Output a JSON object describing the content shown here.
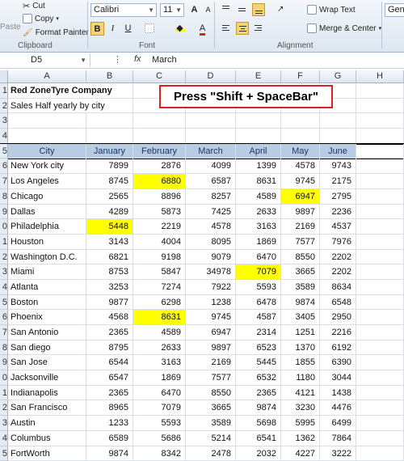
{
  "ribbon": {
    "clipboard": {
      "paste": "Paste",
      "cut": "Cut",
      "copy": "Copy",
      "format_painter": "Format Painter",
      "label": "Clipboard"
    },
    "font": {
      "name": "Calibri",
      "size": "11",
      "bold": "B",
      "italic": "I",
      "underline": "U",
      "grow": "A",
      "shrink": "A",
      "label": "Font"
    },
    "alignment": {
      "wrap_text": "Wrap Text",
      "merge_center": "Merge & Center",
      "label": "Alignment"
    },
    "number": {
      "format": "Gene"
    }
  },
  "formula_bar": {
    "name_box": "D5",
    "fx": "fx",
    "value": "March"
  },
  "columns": [
    "A",
    "B",
    "C",
    "D",
    "E",
    "F",
    "G",
    "H"
  ],
  "title_rows": {
    "company": "Red ZoneTyre Company",
    "subtitle": "Sales Half yearly by city"
  },
  "callout": "Press \"Shift + SpaceBar\"",
  "table": {
    "headers": [
      "City",
      "January",
      "February",
      "March",
      "April",
      "May",
      "June"
    ],
    "rows": [
      {
        "rownum": "6",
        "cells": [
          "New York city",
          "7899",
          "2876",
          "4099",
          "1399",
          "4578",
          "9743"
        ]
      },
      {
        "rownum": "7",
        "cells": [
          "Los Angeles",
          "8745",
          "6880",
          "6587",
          "8631",
          "9745",
          "2175"
        ]
      },
      {
        "rownum": "8",
        "cells": [
          "Chicago",
          "2565",
          "8896",
          "8257",
          "4589",
          "6947",
          "2795"
        ]
      },
      {
        "rownum": "9",
        "cells": [
          "Dallas",
          "4289",
          "5873",
          "7425",
          "2633",
          "9897",
          "2236"
        ]
      },
      {
        "rownum": "0",
        "cells": [
          "Philadelphia",
          "5448",
          "2219",
          "4578",
          "3163",
          "2169",
          "4537"
        ]
      },
      {
        "rownum": "1",
        "cells": [
          "Houston",
          "3143",
          "4004",
          "8095",
          "1869",
          "7577",
          "7976"
        ]
      },
      {
        "rownum": "2",
        "cells": [
          "Washington D.C.",
          "6821",
          "9198",
          "9079",
          "6470",
          "8550",
          "2202"
        ]
      },
      {
        "rownum": "3",
        "cells": [
          "Miami",
          "8753",
          "5847",
          "34978",
          "7079",
          "3665",
          "2202"
        ]
      },
      {
        "rownum": "4",
        "cells": [
          "Atlanta",
          "3253",
          "7274",
          "7922",
          "5593",
          "3589",
          "8634"
        ]
      },
      {
        "rownum": "5",
        "cells": [
          "Boston",
          "9877",
          "6298",
          "1238",
          "6478",
          "9874",
          "6548"
        ]
      },
      {
        "rownum": "6",
        "cells": [
          "Phoenix",
          "4568",
          "8631",
          "9745",
          "4587",
          "3405",
          "2950"
        ]
      },
      {
        "rownum": "7",
        "cells": [
          "San Antonio",
          "2365",
          "4589",
          "6947",
          "2314",
          "1251",
          "2216"
        ]
      },
      {
        "rownum": "8",
        "cells": [
          "San diego",
          "8795",
          "2633",
          "9897",
          "6523",
          "1370",
          "6192"
        ]
      },
      {
        "rownum": "9",
        "cells": [
          "San Jose",
          "6544",
          "3163",
          "2169",
          "5445",
          "1855",
          "6390"
        ]
      },
      {
        "rownum": "0",
        "cells": [
          "Jacksonville",
          "6547",
          "1869",
          "7577",
          "6532",
          "1180",
          "3044"
        ]
      },
      {
        "rownum": "1",
        "cells": [
          "Indianapolis",
          "2365",
          "6470",
          "8550",
          "2365",
          "4121",
          "1438"
        ]
      },
      {
        "rownum": "2",
        "cells": [
          "San Francisco",
          "8965",
          "7079",
          "3665",
          "9874",
          "3230",
          "4476"
        ]
      },
      {
        "rownum": "3",
        "cells": [
          "Austin",
          "1233",
          "5593",
          "3589",
          "5698",
          "5995",
          "6499"
        ]
      },
      {
        "rownum": "4",
        "cells": [
          "Columbus",
          "6589",
          "5686",
          "5214",
          "6541",
          "1362",
          "7864"
        ]
      },
      {
        "rownum": "5",
        "cells": [
          "FortWorth",
          "9874",
          "8342",
          "2478",
          "2032",
          "4227",
          "3222"
        ]
      }
    ],
    "highlights": [
      [
        1,
        2
      ],
      [
        2,
        5
      ],
      [
        4,
        1
      ],
      [
        7,
        4
      ],
      [
        10,
        2
      ]
    ]
  },
  "colors": {
    "highlight": "#ffff00",
    "header_fill": "#b8cce4",
    "callout_border": "#e02020"
  }
}
